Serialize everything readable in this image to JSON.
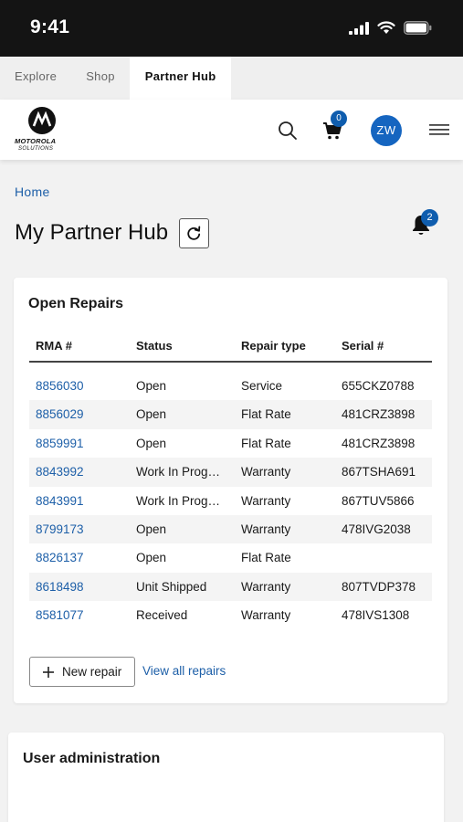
{
  "status_bar": {
    "time": "9:41"
  },
  "top_tabs": [
    {
      "label": "Explore"
    },
    {
      "label": "Shop"
    },
    {
      "label": "Partner Hub",
      "active": true
    }
  ],
  "header": {
    "logo_name": "MOTOROLA",
    "logo_sub": "SOLUTIONS",
    "cart_count": "0",
    "avatar_initials": "ZW",
    "icons": [
      "search-icon",
      "cart-icon",
      "menu-icon"
    ]
  },
  "breadcrumb": "Home",
  "page_title": "My Partner Hub",
  "notifications_count": "2",
  "repairs": {
    "title": "Open Repairs",
    "columns": [
      "RMA #",
      "Status",
      "Repair type",
      "Serial #"
    ],
    "rows": [
      {
        "rma": "8856030",
        "status": "Open",
        "type": "Service",
        "serial": "655CKZ0788"
      },
      {
        "rma": "8856029",
        "status": "Open",
        "type": "Flat Rate",
        "serial": "481CRZ3898"
      },
      {
        "rma": "8859991",
        "status": "Open",
        "type": "Flat Rate",
        "serial": "481CRZ3898"
      },
      {
        "rma": "8843992",
        "status": "Work In Prog…",
        "type": "Warranty",
        "serial": "867TSHA691"
      },
      {
        "rma": "8843991",
        "status": "Work In Prog…",
        "type": "Warranty",
        "serial": "867TUV5866"
      },
      {
        "rma": "8799173",
        "status": "Open",
        "type": "Warranty",
        "serial": "478IVG2038"
      },
      {
        "rma": "8826137",
        "status": "Open",
        "type": "Flat Rate",
        "serial": ""
      },
      {
        "rma": "8618498",
        "status": "Unit Shipped",
        "type": "Warranty",
        "serial": "807TVDP378"
      },
      {
        "rma": "8581077",
        "status": "Received",
        "type": "Warranty",
        "serial": "478IVS1308"
      }
    ],
    "new_repair_label": "New repair",
    "view_all_label": "View all repairs"
  },
  "admin": {
    "title": "User administration"
  },
  "colors": {
    "link": "#1d5fa8",
    "badge": "#0f5dae",
    "avatar": "#1565c0",
    "status_bar": "#141414"
  }
}
